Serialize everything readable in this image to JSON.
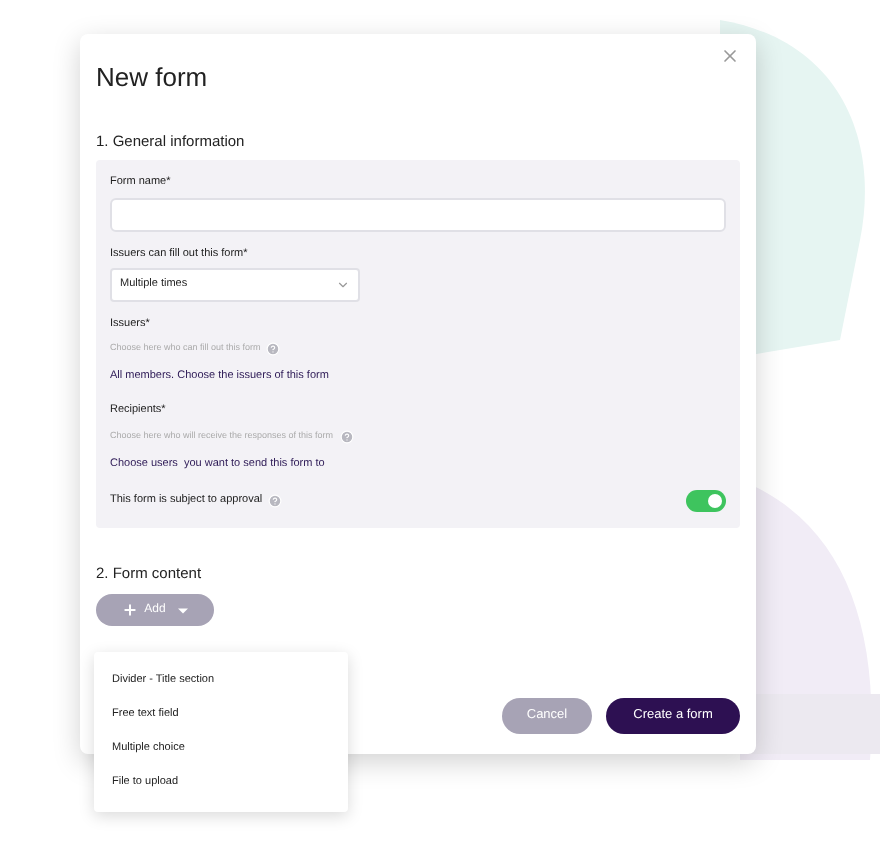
{
  "dialog": {
    "title": "New form"
  },
  "section_general": {
    "heading": "1. General information",
    "form_name": {
      "label": "Form name*"
    },
    "issuers_frequency": {
      "label": "Issuers can fill out this form*",
      "value": "Multiple times"
    },
    "issuers": {
      "label": "Issuers*",
      "hint": "Choose here who can fill out this form",
      "link": "All members. Choose the issuers of this form"
    },
    "recipients": {
      "label": "Recipients*",
      "hint": "Choose here who will receive the responses of this form",
      "link": "Choose users  you want to send this form to"
    },
    "approval": {
      "label": "This form is subject to approval",
      "on": true
    }
  },
  "section_content": {
    "heading": "2. Form content",
    "add_button": "Add",
    "menu": [
      {
        "label": "Divider - Title section"
      },
      {
        "label": "Free text field"
      },
      {
        "label": "Multiple choice"
      },
      {
        "label": "File to upload"
      }
    ]
  },
  "buttons": {
    "cancel": "Cancel",
    "create": "Create a form"
  }
}
